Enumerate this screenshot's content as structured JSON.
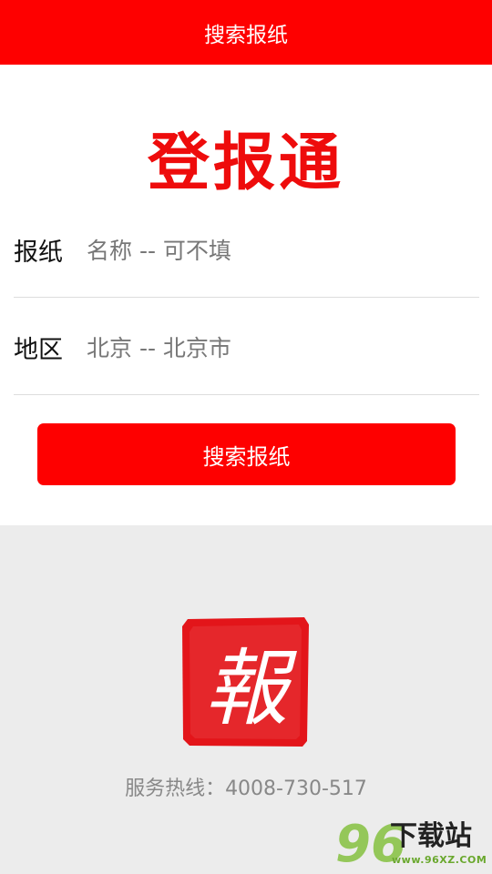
{
  "header": {
    "title": "搜索报纸"
  },
  "brand": {
    "name": "登报通"
  },
  "form": {
    "newspaper": {
      "label": "报纸",
      "value": "名称 -- 可不填"
    },
    "region": {
      "label": "地区",
      "value": "北京 -- 北京市"
    },
    "submit_label": "搜索报纸"
  },
  "footer": {
    "seal_char": "報",
    "hotline": "服务热线：4008-730-517"
  },
  "watermark": {
    "number": "96",
    "text": "下载站",
    "url": "www.96XZ.COM"
  },
  "colors": {
    "primary": "#fe0000",
    "brand_text": "#ee0c0c",
    "footer_bg": "#ececec"
  }
}
